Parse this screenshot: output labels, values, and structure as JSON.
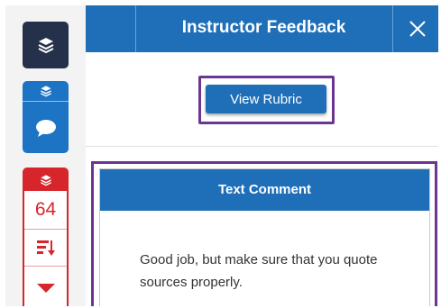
{
  "header": {
    "title": "Instructor Feedback",
    "close_label": "×"
  },
  "rail": {
    "score": "64",
    "icons": [
      "layers-icon",
      "comment-icon",
      "sort-icon",
      "caret-down-icon"
    ]
  },
  "rubric": {
    "button_label": "View Rubric"
  },
  "comment": {
    "heading": "Text Comment",
    "text": "Good job, but make sure that you quote sources properly."
  },
  "colors": {
    "primary": "#1f6fb8",
    "dark": "#25304a",
    "alert": "#d6262b",
    "highlight": "#6b3591"
  }
}
